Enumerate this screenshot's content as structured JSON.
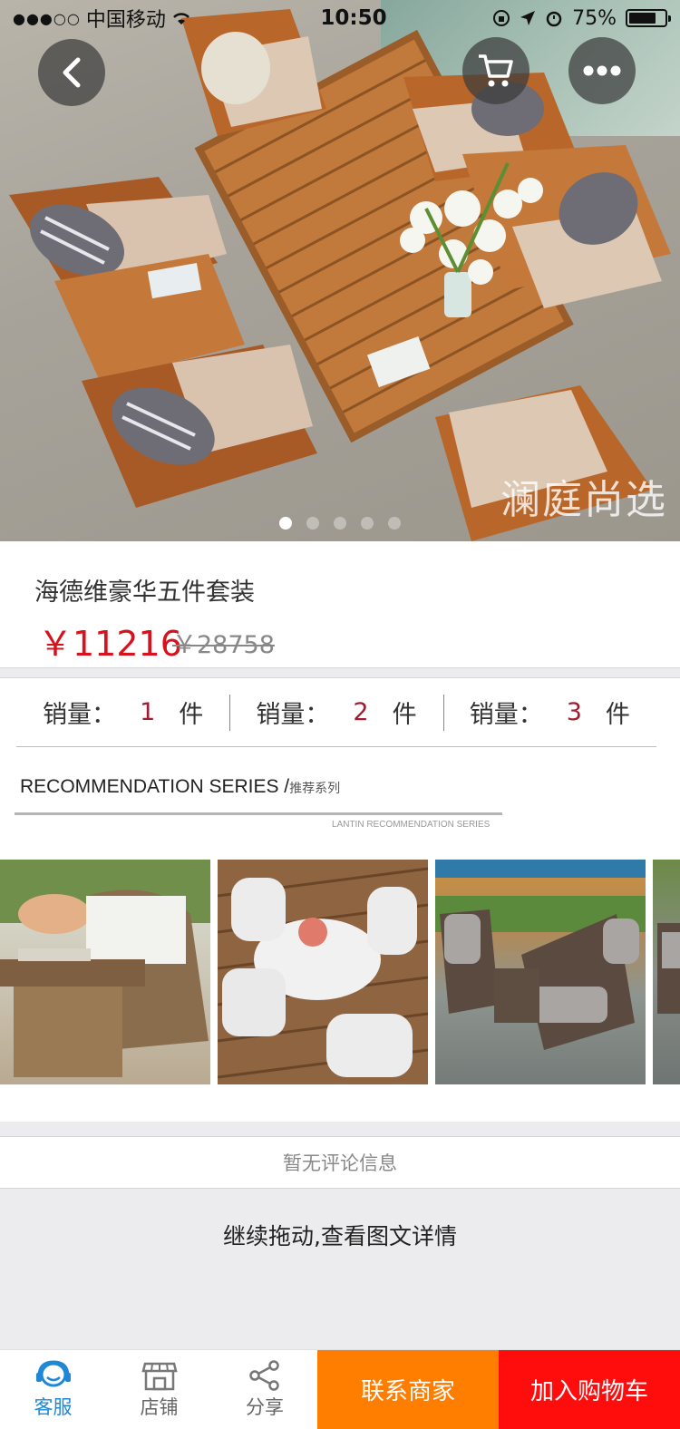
{
  "status_bar": {
    "signal": "●●●○○",
    "carrier": "中国移动",
    "time": "10:50",
    "battery_text": "75%",
    "battery_level": 0.75
  },
  "header": {
    "back_icon": "chevron-left-icon",
    "cart_icon": "cart-icon",
    "more_icon": "more-dots-icon"
  },
  "carousel": {
    "watermark": "澜庭尚选",
    "slide_count": 5,
    "active_index": 0
  },
  "product": {
    "title": "海德维豪华五件套装",
    "price": "￥11216",
    "original_price": "￥28758"
  },
  "sales": [
    {
      "label": "销量：",
      "value": "1",
      "unit": "件"
    },
    {
      "label": "销量：",
      "value": "2",
      "unit": "件"
    },
    {
      "label": "销量：",
      "value": "3",
      "unit": "件"
    }
  ],
  "recommendation": {
    "title": "RECOMMENDATION SERIES /",
    "title_cn": "推荐系列",
    "subtitle_en": "LANTIN RECOMMENDATION SERIES"
  },
  "comments": {
    "empty_text": "暂无评论信息"
  },
  "drag_hint": "继续拖动,查看图文详情",
  "bottom_bar": {
    "tabs": [
      {
        "label": "客服",
        "icon": "customer-service-icon",
        "active": true
      },
      {
        "label": "店铺",
        "icon": "store-icon",
        "active": false
      },
      {
        "label": "分享",
        "icon": "share-icon",
        "active": false
      }
    ],
    "contact_label": "联系商家",
    "add_cart_label": "加入购物车"
  },
  "colors": {
    "price_red": "#d8121d",
    "contact_orange": "#ff7e00",
    "cart_red": "#ff0d0d",
    "active_blue": "#1e88d6"
  }
}
